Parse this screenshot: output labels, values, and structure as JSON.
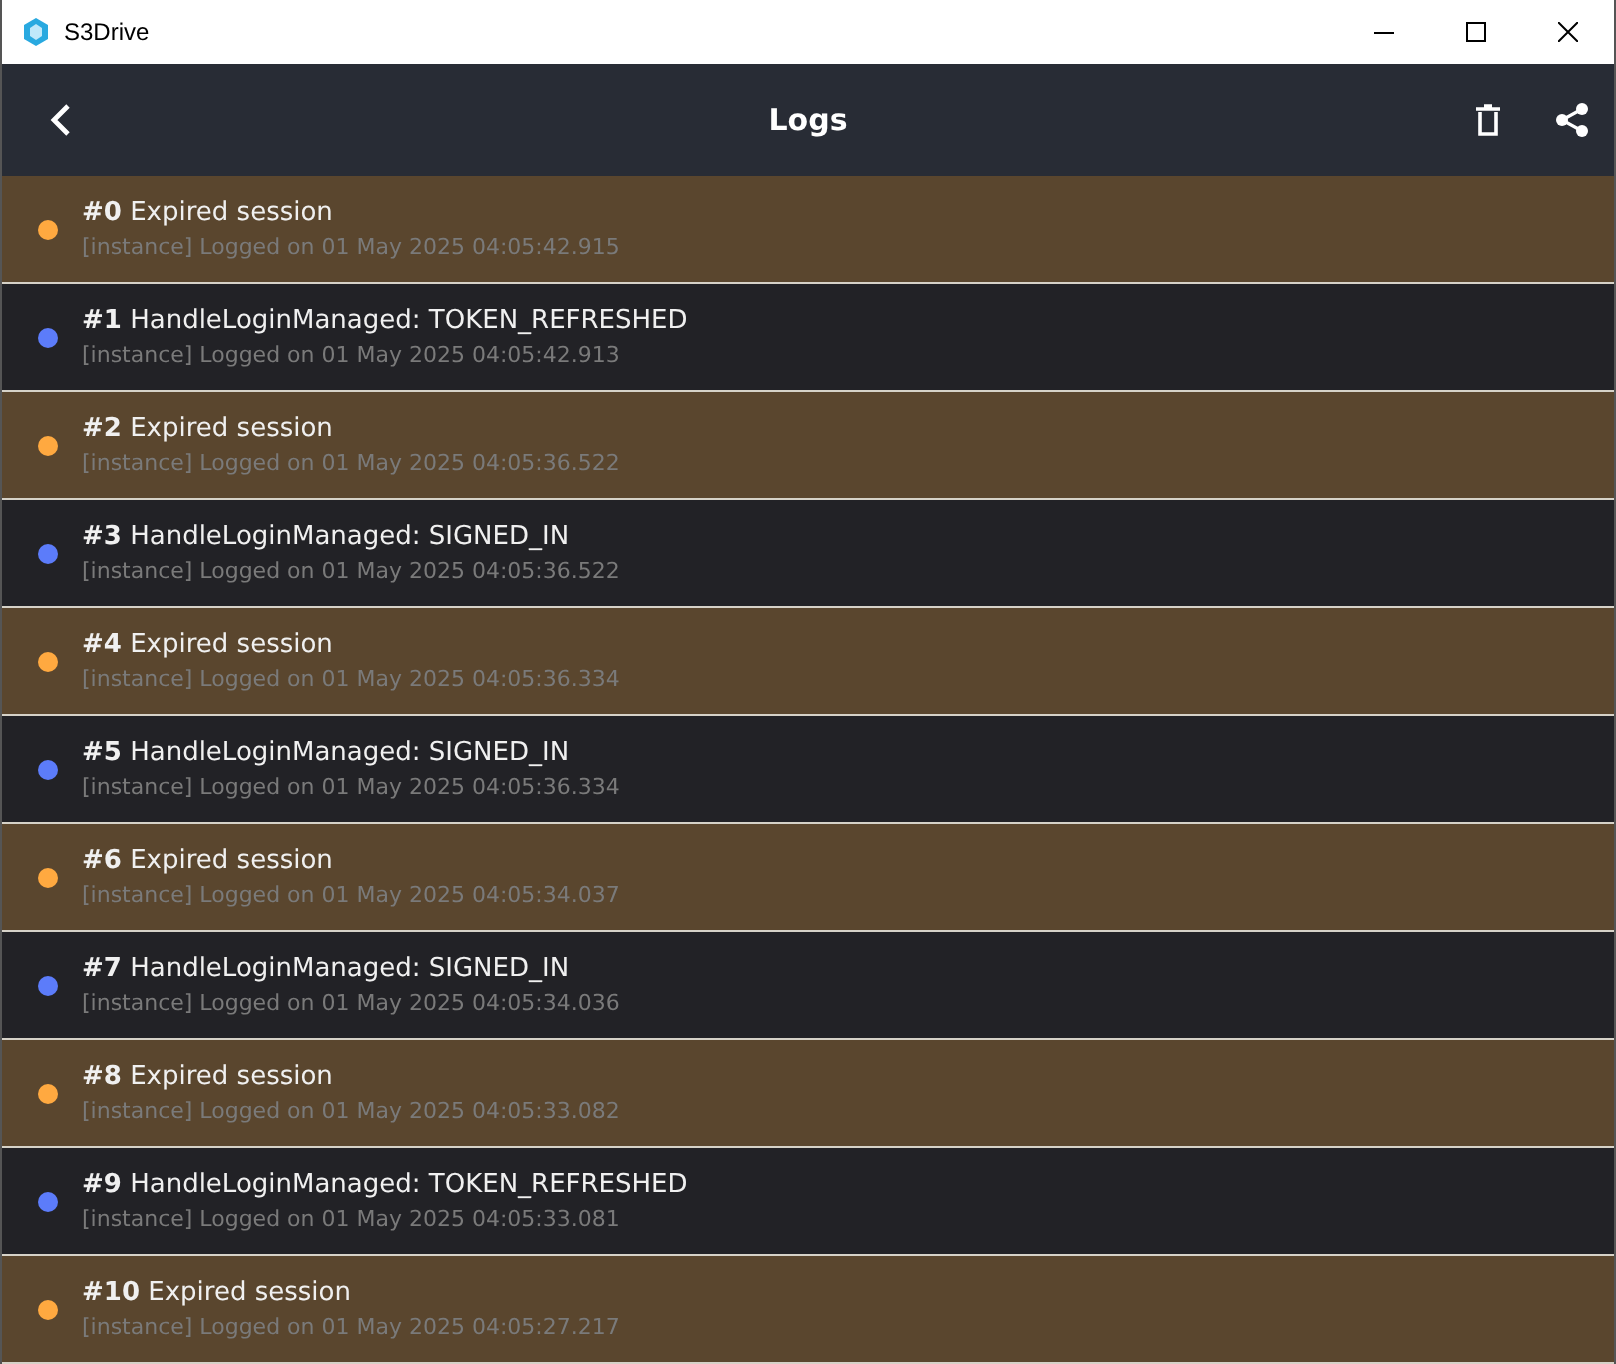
{
  "window": {
    "title": "S3Drive"
  },
  "app_bar": {
    "title": "Logs"
  },
  "logs": [
    {
      "kind": "warning",
      "color": "#ffa940",
      "number": "#0",
      "message": "Expired session",
      "meta": "[instance] Logged on 01 May 2025 04:05:42.915"
    },
    {
      "kind": "info",
      "color": "#5c7cfa",
      "number": "#1",
      "message": "HandleLoginManaged: TOKEN_REFRESHED",
      "meta": "[instance] Logged on 01 May 2025 04:05:42.913"
    },
    {
      "kind": "warning",
      "color": "#ffa940",
      "number": "#2",
      "message": "Expired session",
      "meta": "[instance] Logged on 01 May 2025 04:05:36.522"
    },
    {
      "kind": "info",
      "color": "#5c7cfa",
      "number": "#3",
      "message": "HandleLoginManaged: SIGNED_IN",
      "meta": "[instance] Logged on 01 May 2025 04:05:36.522"
    },
    {
      "kind": "warning",
      "color": "#ffa940",
      "number": "#4",
      "message": "Expired session",
      "meta": "[instance] Logged on 01 May 2025 04:05:36.334"
    },
    {
      "kind": "info",
      "color": "#5c7cfa",
      "number": "#5",
      "message": "HandleLoginManaged: SIGNED_IN",
      "meta": "[instance] Logged on 01 May 2025 04:05:36.334"
    },
    {
      "kind": "warning",
      "color": "#ffa940",
      "number": "#6",
      "message": "Expired session",
      "meta": "[instance] Logged on 01 May 2025 04:05:34.037"
    },
    {
      "kind": "info",
      "color": "#5c7cfa",
      "number": "#7",
      "message": "HandleLoginManaged: SIGNED_IN",
      "meta": "[instance] Logged on 01 May 2025 04:05:34.036"
    },
    {
      "kind": "warning",
      "color": "#ffa940",
      "number": "#8",
      "message": "Expired session",
      "meta": "[instance] Logged on 01 May 2025 04:05:33.082"
    },
    {
      "kind": "info",
      "color": "#5c7cfa",
      "number": "#9",
      "message": "HandleLoginManaged: TOKEN_REFRESHED",
      "meta": "[instance] Logged on 01 May 2025 04:05:33.081"
    },
    {
      "kind": "warning",
      "color": "#ffa940",
      "number": "#10",
      "message": "Expired session",
      "meta": "[instance] Logged on 01 May 2025 04:05:27.217"
    }
  ]
}
